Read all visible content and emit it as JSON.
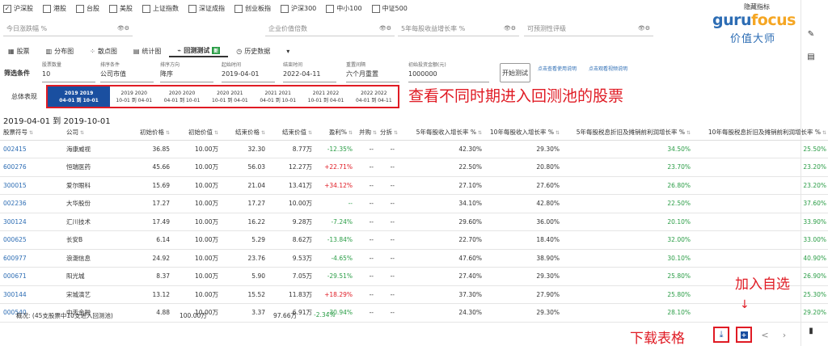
{
  "markets": [
    {
      "label": "沪深股",
      "checked": true
    },
    {
      "label": "港股",
      "checked": false
    },
    {
      "label": "台股",
      "checked": false
    },
    {
      "label": "美股",
      "checked": false
    },
    {
      "label": "上证指数",
      "checked": false
    },
    {
      "label": "深证成指",
      "checked": false
    },
    {
      "label": "创业板指",
      "checked": false
    },
    {
      "label": "沪深300",
      "checked": false
    },
    {
      "label": "中小100",
      "checked": false
    },
    {
      "label": "中证500",
      "checked": false
    }
  ],
  "top_right": {
    "link_text": "隐藏指标"
  },
  "logo": {
    "en_main": "guru",
    "en_accent": "focus",
    "cn": "价值大师"
  },
  "filters": [
    {
      "label": "今日涨跌幅 %"
    },
    {
      "label": "企业价值倍数"
    },
    {
      "label": "5年每股收益增长率 %"
    },
    {
      "label": "可预测性评级"
    }
  ],
  "tabs": [
    {
      "label": "股票",
      "icon": "grid-icon"
    },
    {
      "label": "分布图",
      "icon": "bars-icon"
    },
    {
      "label": "散点图",
      "icon": "scatter-icon"
    },
    {
      "label": "统计图",
      "icon": "chart-icon"
    },
    {
      "label": "回测测试",
      "icon": "line-icon",
      "badge": "新",
      "active": true
    },
    {
      "label": "历史数据",
      "icon": "clock-icon"
    }
  ],
  "settings": {
    "section_label": "筛选条件",
    "fields": [
      {
        "label": "股票数量",
        "value": "10"
      },
      {
        "label": "排序条件",
        "value": "公司市值"
      },
      {
        "label": "排序方向",
        "value": "降序"
      },
      {
        "label": "起始时间",
        "value": "2019-04-01"
      },
      {
        "label": "结束时间",
        "value": "2022-04-11"
      },
      {
        "label": "重置间隔",
        "value": "六个月重置"
      },
      {
        "label": "初始投资金额(元)",
        "value": "1000000"
      }
    ],
    "run_button": "开始测试",
    "help_link_1": "点击查看使用说明",
    "help_link_2": "点击观看视频说明"
  },
  "periods": {
    "label": "总体表现",
    "items": [
      {
        "line1": "2019  2019",
        "line2": "04-01 到 10-01",
        "active": true
      },
      {
        "line1": "2019  2020",
        "line2": "10-01 到 04-01"
      },
      {
        "line1": "2020  2020",
        "line2": "04-01 到 10-01"
      },
      {
        "line1": "2020  2021",
        "line2": "10-01 到 04-01"
      },
      {
        "line1": "2021  2021",
        "line2": "04-01 到 10-01"
      },
      {
        "line1": "2021  2022",
        "line2": "10-01 到 04-01"
      },
      {
        "line1": "2022  2022",
        "line2": "04-01 到 04-11"
      }
    ],
    "annotation": "查看不同时期进入回测池的股票"
  },
  "range_title": "2019-04-01 到 2019-10-01",
  "table": {
    "headers": [
      "股票符号",
      "公司",
      "初始价格",
      "初始价值",
      "结束价格",
      "结束价值",
      "盈利%",
      "并购",
      "分拆",
      "5年每股收入增长率 %",
      "10年每股收入增长率 %",
      "5年每股税息折旧及摊销前利润增长率 %",
      "10年每股税息折旧及摊销前利润增长率 %",
      ""
    ],
    "rows": [
      [
        "002415",
        "海康威视",
        "36.85",
        "10.00万",
        "32.30",
        "8.77万",
        "-12.35%",
        "--",
        "--",
        "42.30%",
        "29.30%",
        "34.50%",
        "25.50%"
      ],
      [
        "600276",
        "恒瑞医药",
        "45.66",
        "10.00万",
        "56.03",
        "12.27万",
        "+22.71%",
        "--",
        "--",
        "22.50%",
        "20.80%",
        "23.70%",
        "23.20%"
      ],
      [
        "300015",
        "爱尔眼科",
        "15.69",
        "10.00万",
        "21.04",
        "13.41万",
        "+34.12%",
        "--",
        "--",
        "27.10%",
        "27.60%",
        "26.80%",
        "23.20%"
      ],
      [
        "002236",
        "大华股份",
        "17.27",
        "10.00万",
        "17.27",
        "10.00万",
        "--",
        "--",
        "--",
        "34.10%",
        "42.80%",
        "22.50%",
        "37.60%"
      ],
      [
        "300124",
        "汇川技术",
        "17.49",
        "10.00万",
        "16.22",
        "9.28万",
        "-7.24%",
        "--",
        "--",
        "29.60%",
        "36.00%",
        "20.10%",
        "33.90%"
      ],
      [
        "000625",
        "长安B",
        "6.14",
        "10.00万",
        "5.29",
        "8.62万",
        "-13.84%",
        "--",
        "--",
        "22.70%",
        "18.40%",
        "32.00%",
        "33.00%"
      ],
      [
        "600977",
        "浪潮信息",
        "24.92",
        "10.00万",
        "23.76",
        "9.53万",
        "-4.65%",
        "--",
        "--",
        "47.60%",
        "38.90%",
        "30.10%",
        "40.90%"
      ],
      [
        "000671",
        "阳光城",
        "8.37",
        "10.00万",
        "5.90",
        "7.05万",
        "-29.51%",
        "--",
        "--",
        "27.40%",
        "29.30%",
        "25.80%",
        "26.90%"
      ],
      [
        "300144",
        "宋城演艺",
        "13.12",
        "10.00万",
        "15.52",
        "11.83万",
        "+18.29%",
        "--",
        "--",
        "37.30%",
        "27.90%",
        "25.80%",
        "25.30%"
      ],
      [
        "000540",
        "中天金融",
        "4.88",
        "10.00万",
        "3.37",
        "6.91万",
        "-30.94%",
        "--",
        "--",
        "24.30%",
        "29.30%",
        "28.10%",
        "29.20%"
      ]
    ]
  },
  "summary": {
    "label": "概况: (45支股票中10支进入回测池)",
    "initial_total": "100.00万",
    "end_total": "97.66万",
    "profit": "-2.34%"
  },
  "annotations": {
    "add_watchlist": "加入自选",
    "arrow": "↓",
    "download_table": "下载表格"
  }
}
